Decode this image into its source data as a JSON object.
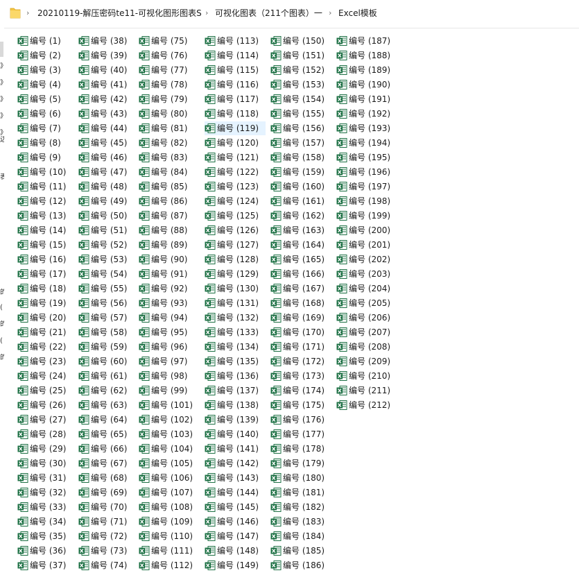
{
  "address": {
    "crumbs": [
      "20210119-解压密码te11-可视化图形图表S",
      "可视化图表（211个图表）一",
      "Excel模板"
    ],
    "separator": "›"
  },
  "icons": {
    "folder": "folder-icon",
    "file": "excel-file-icon",
    "excel_green": "#1d7044",
    "folder_yellow": "#f5c542"
  },
  "files": {
    "prefix": "编号",
    "columns": [
      [
        1,
        2,
        3,
        4,
        5,
        6,
        7,
        8,
        9,
        10,
        11,
        12,
        13,
        14,
        15,
        16,
        17,
        18,
        19,
        20,
        21,
        22,
        23,
        24,
        25,
        26,
        27,
        28,
        29,
        30,
        31,
        32,
        33,
        34,
        35,
        36,
        37
      ],
      [
        38,
        39,
        40,
        41,
        42,
        43,
        44,
        45,
        46,
        47,
        48,
        49,
        50,
        51,
        52,
        53,
        54,
        55,
        56,
        57,
        58,
        59,
        60,
        61,
        62,
        63,
        64,
        65,
        66,
        67,
        68,
        69,
        70,
        71,
        72,
        73,
        74
      ],
      [
        75,
        76,
        77,
        78,
        79,
        80,
        81,
        82,
        83,
        84,
        85,
        86,
        87,
        88,
        89,
        90,
        91,
        92,
        93,
        94,
        95,
        96,
        97,
        98,
        99,
        101,
        102,
        103,
        104,
        105,
        106,
        107,
        108,
        109,
        110,
        111,
        112
      ],
      [
        113,
        114,
        115,
        116,
        117,
        118,
        119,
        120,
        121,
        122,
        123,
        124,
        125,
        126,
        127,
        128,
        129,
        130,
        131,
        132,
        133,
        134,
        135,
        136,
        137,
        138,
        139,
        140,
        141,
        142,
        143,
        144,
        145,
        146,
        147,
        148,
        149
      ],
      [
        150,
        151,
        152,
        153,
        154,
        155,
        156,
        157,
        158,
        159,
        160,
        161,
        162,
        163,
        164,
        165,
        166,
        167,
        168,
        169,
        170,
        171,
        172,
        173,
        174,
        175,
        176,
        177,
        178,
        179,
        180,
        181,
        182,
        183,
        184,
        185,
        186
      ],
      [
        187,
        188,
        189,
        190,
        191,
        192,
        193,
        194,
        195,
        196,
        197,
        198,
        199,
        200,
        201,
        202,
        203,
        204,
        205,
        206,
        207,
        208,
        209,
        210,
        211,
        212
      ]
    ],
    "selected": 119
  },
  "left_pane_fragments": [
    "》",
    "》",
    "》",
    "》",
    "》",
    "边",
    "表",
    "的",
    "(",
    "的",
    "(",
    "的"
  ]
}
